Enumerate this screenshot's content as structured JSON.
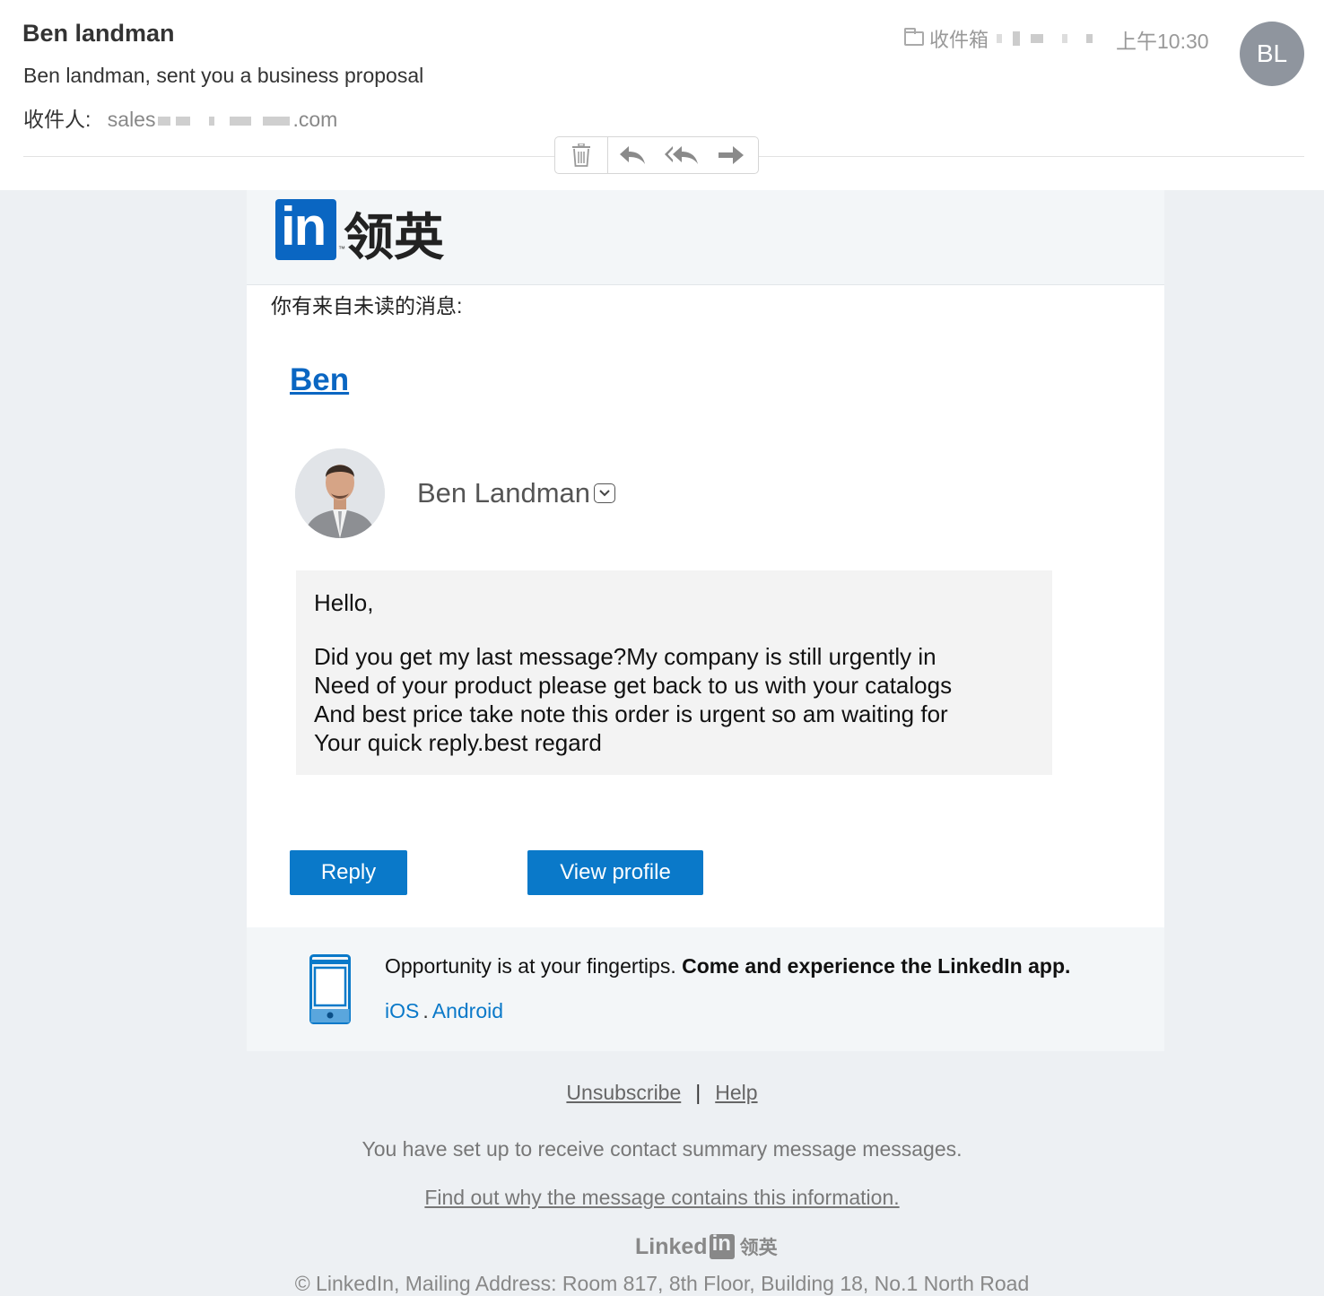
{
  "header": {
    "sender": "Ben landman",
    "subject": "Ben landman, sent you a business proposal",
    "recipient_label": "收件人:",
    "recipient_prefix": "sales",
    "recipient_suffix": ".com",
    "folder": "收件箱",
    "time": "上午10:30",
    "avatar_initials": "BL"
  },
  "toolbar": {
    "delete": "trash-icon",
    "reply": "reply-icon",
    "reply_all": "reply-all-icon",
    "forward": "forward-icon"
  },
  "card": {
    "brand_mark": "in",
    "brand_tm": "™",
    "brand_cn": "领英",
    "unread": "你有来自未读的消息:",
    "sender_link": "Ben",
    "sender_full": "Ben Landman",
    "message_greeting": "Hello,",
    "message_lines": [
      "Did you get my last message?My company is still urgently in",
      "Need of your product please get back to us with your catalogs",
      "And best price take note this order is urgent so am waiting for",
      "Your quick reply.best regard"
    ],
    "reply_button": "Reply",
    "view_profile_button": "View profile",
    "promo_text": "Opportunity is at your fingertips.",
    "promo_bold": "Come and experience the LinkedIn app.",
    "ios": "iOS",
    "dot": ".",
    "android": "Android"
  },
  "footer": {
    "unsubscribe": "Unsubscribe",
    "bar": "|",
    "help": "Help",
    "note": "You have set up to receive contact summary message messages.",
    "find_out": "Find out why the message contains this information.",
    "logo_word": "Linked",
    "logo_box": "in",
    "logo_cn": "领英",
    "address": "© LinkedIn, Mailing Address: Room 817, 8th Floor, Building 18, No.1 North Road"
  },
  "colors": {
    "brand_blue": "#0a66c2",
    "button_blue": "#0a79c9",
    "background": "#edf0f3"
  }
}
